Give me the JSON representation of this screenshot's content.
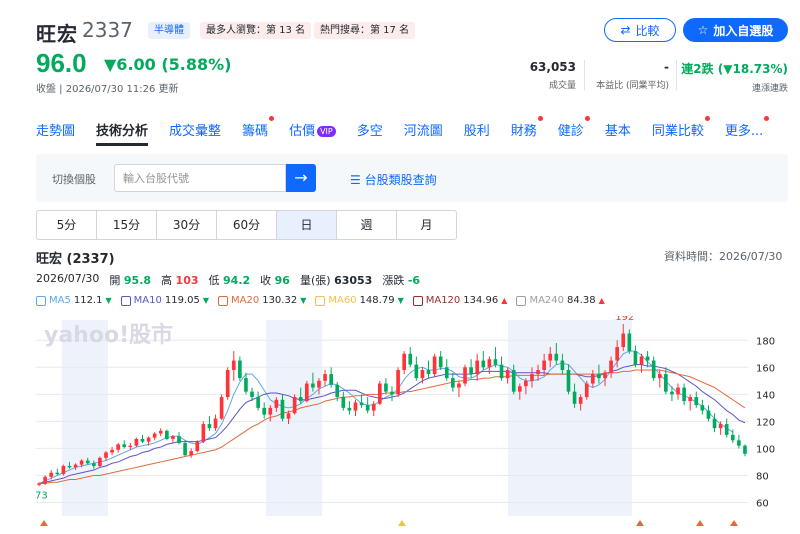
{
  "header": {
    "name": "旺宏",
    "code": "2337",
    "tags": {
      "sector": "半導體",
      "views": "最多人瀏覽：第 13 名",
      "hot": "熱門搜尋：第 17 名"
    },
    "compare_label": "比較",
    "watch_label": "加入自選股",
    "price": "96.0",
    "change": "▼6.00 (5.88%)",
    "update_line": "收盤 | 2026/07/30 11:26 更新"
  },
  "stats": [
    {
      "value": "63,053",
      "label": "成交量"
    },
    {
      "value": "-",
      "label": "本益比 (同業平均)"
    },
    {
      "value": "連2跌 (▼18.73%)",
      "label": "連漲連跌"
    }
  ],
  "tabs": [
    {
      "label": "走勢圖",
      "dot": false
    },
    {
      "label": "技術分析",
      "dot": false,
      "active": true
    },
    {
      "label": "成交彙整",
      "dot": false
    },
    {
      "label": "籌碼",
      "dot": true
    },
    {
      "label": "估價",
      "dot": false,
      "vip": "VIP"
    },
    {
      "label": "多空",
      "dot": false
    },
    {
      "label": "河流圖",
      "dot": false
    },
    {
      "label": "股利",
      "dot": false
    },
    {
      "label": "財務",
      "dot": true
    },
    {
      "label": "健診",
      "dot": true
    },
    {
      "label": "基本",
      "dot": false
    },
    {
      "label": "同業比較",
      "dot": true
    },
    {
      "label": "更多...",
      "dot": true
    }
  ],
  "search": {
    "switch_label": "切換個股",
    "placeholder": "輸入台股代號",
    "go_icon": "→",
    "category_link": "台股類股查詢"
  },
  "periods": [
    {
      "label": "5分"
    },
    {
      "label": "15分"
    },
    {
      "label": "30分"
    },
    {
      "label": "60分"
    },
    {
      "label": "日",
      "active": true
    },
    {
      "label": "週"
    },
    {
      "label": "月"
    }
  ],
  "chart_header": {
    "title": "旺宏 (2337)",
    "data_time": "資料時間：2026/07/30",
    "date": "2026/07/30",
    "open_label": "開",
    "open": "95.8",
    "high_label": "高",
    "high": "103",
    "low_label": "低",
    "low": "94.2",
    "close_label": "收",
    "close": "96",
    "volume_label": "量(張)",
    "volume": "63053",
    "change_label": "漲跌",
    "change": "-6"
  },
  "ma_legend": [
    {
      "label": "MA5",
      "value": "112.1",
      "arrow": "▼",
      "color": "#5fa8e6"
    },
    {
      "label": "MA10",
      "value": "119.05",
      "arrow": "▼",
      "color": "#5a55c8"
    },
    {
      "label": "MA20",
      "value": "130.32",
      "arrow": "▼",
      "color": "#e06b3c"
    },
    {
      "label": "MA60",
      "value": "148.79",
      "arrow": "▼",
      "color": "#f2c14a"
    },
    {
      "label": "MA120",
      "value": "134.96",
      "arrow": "▲",
      "color": "#9b2d2d"
    },
    {
      "label": "MA240",
      "value": "84.38",
      "arrow": "▲",
      "color": "#9aa0a6"
    }
  ],
  "colors": {
    "up": "#ff333a",
    "down": "#00ab5e",
    "accent": "#0f69ff"
  },
  "chart_data": {
    "type": "candlestick",
    "watermark": "yahoo!股市",
    "y_ticks": [
      60,
      80,
      100,
      120,
      140,
      160,
      180
    ],
    "ylim": [
      50,
      195
    ],
    "max_label": "192",
    "min_label": "73",
    "grid": true,
    "candles": [
      [
        73,
        75,
        72,
        74
      ],
      [
        74,
        80,
        73,
        79
      ],
      [
        79,
        84,
        77,
        82
      ],
      [
        82,
        85,
        80,
        81
      ],
      [
        81,
        88,
        80,
        87
      ],
      [
        87,
        90,
        85,
        86
      ],
      [
        86,
        89,
        84,
        88
      ],
      [
        88,
        92,
        86,
        91
      ],
      [
        91,
        93,
        88,
        89
      ],
      [
        89,
        91,
        85,
        87
      ],
      [
        87,
        94,
        86,
        93
      ],
      [
        93,
        98,
        91,
        97
      ],
      [
        97,
        101,
        95,
        99
      ],
      [
        99,
        104,
        97,
        103
      ],
      [
        103,
        106,
        100,
        101
      ],
      [
        101,
        104,
        99,
        102
      ],
      [
        102,
        108,
        101,
        107
      ],
      [
        107,
        110,
        104,
        105
      ],
      [
        105,
        109,
        102,
        108
      ],
      [
        108,
        112,
        106,
        111
      ],
      [
        111,
        115,
        109,
        113
      ],
      [
        113,
        114,
        106,
        107
      ],
      [
        107,
        110,
        104,
        109
      ],
      [
        109,
        112,
        103,
        104
      ],
      [
        104,
        106,
        94,
        95
      ],
      [
        95,
        100,
        93,
        98
      ],
      [
        98,
        106,
        97,
        105
      ],
      [
        105,
        120,
        104,
        118
      ],
      [
        118,
        124,
        113,
        115
      ],
      [
        115,
        125,
        113,
        122
      ],
      [
        122,
        140,
        121,
        138
      ],
      [
        138,
        160,
        136,
        158
      ],
      [
        158,
        172,
        150,
        165
      ],
      [
        165,
        168,
        150,
        152
      ],
      [
        152,
        156,
        140,
        142
      ],
      [
        142,
        145,
        135,
        138
      ],
      [
        138,
        142,
        128,
        130
      ],
      [
        130,
        134,
        122,
        125
      ],
      [
        125,
        132,
        120,
        130
      ],
      [
        130,
        138,
        127,
        136
      ],
      [
        136,
        140,
        120,
        122
      ],
      [
        122,
        128,
        118,
        126
      ],
      [
        126,
        140,
        125,
        138
      ],
      [
        138,
        145,
        133,
        135
      ],
      [
        135,
        150,
        134,
        148
      ],
      [
        148,
        156,
        142,
        145
      ],
      [
        145,
        152,
        140,
        150
      ],
      [
        150,
        158,
        146,
        155
      ],
      [
        155,
        160,
        145,
        147
      ],
      [
        147,
        149,
        135,
        138
      ],
      [
        138,
        142,
        128,
        130
      ],
      [
        130,
        135,
        125,
        128
      ],
      [
        128,
        136,
        124,
        134
      ],
      [
        134,
        140,
        130,
        132
      ],
      [
        132,
        138,
        126,
        128
      ],
      [
        128,
        135,
        124,
        133
      ],
      [
        133,
        150,
        132,
        148
      ],
      [
        148,
        152,
        140,
        142
      ],
      [
        142,
        146,
        135,
        140
      ],
      [
        140,
        160,
        138,
        158
      ],
      [
        158,
        172,
        155,
        170
      ],
      [
        170,
        175,
        160,
        162
      ],
      [
        162,
        168,
        150,
        152
      ],
      [
        152,
        160,
        148,
        158
      ],
      [
        158,
        165,
        152,
        155
      ],
      [
        155,
        170,
        153,
        168
      ],
      [
        168,
        172,
        158,
        160
      ],
      [
        160,
        166,
        150,
        152
      ],
      [
        152,
        156,
        142,
        145
      ],
      [
        145,
        150,
        138,
        148
      ],
      [
        148,
        162,
        146,
        160
      ],
      [
        160,
        166,
        152,
        155
      ],
      [
        155,
        170,
        150,
        165
      ],
      [
        165,
        172,
        158,
        160
      ],
      [
        160,
        168,
        155,
        166
      ],
      [
        166,
        175,
        160,
        162
      ],
      [
        162,
        168,
        150,
        152
      ],
      [
        152,
        160,
        148,
        158
      ],
      [
        158,
        162,
        140,
        142
      ],
      [
        142,
        148,
        136,
        146
      ],
      [
        146,
        152,
        140,
        150
      ],
      [
        150,
        160,
        145,
        155
      ],
      [
        155,
        162,
        150,
        158
      ],
      [
        158,
        170,
        154,
        165
      ],
      [
        165,
        175,
        160,
        170
      ],
      [
        170,
        178,
        162,
        165
      ],
      [
        165,
        170,
        155,
        158
      ],
      [
        158,
        162,
        140,
        142
      ],
      [
        142,
        148,
        130,
        133
      ],
      [
        133,
        140,
        128,
        138
      ],
      [
        138,
        150,
        136,
        148
      ],
      [
        148,
        158,
        145,
        155
      ],
      [
        155,
        162,
        148,
        152
      ],
      [
        152,
        158,
        146,
        156
      ],
      [
        156,
        168,
        152,
        165
      ],
      [
        165,
        180,
        160,
        175
      ],
      [
        175,
        192,
        172,
        185
      ],
      [
        185,
        188,
        170,
        172
      ],
      [
        172,
        176,
        160,
        162
      ],
      [
        162,
        170,
        156,
        168
      ],
      [
        168,
        172,
        160,
        165
      ],
      [
        165,
        168,
        150,
        152
      ],
      [
        152,
        158,
        145,
        155
      ],
      [
        155,
        160,
        140,
        142
      ],
      [
        142,
        146,
        135,
        140
      ],
      [
        140,
        148,
        136,
        145
      ],
      [
        145,
        148,
        132,
        135
      ],
      [
        135,
        140,
        128,
        138
      ],
      [
        138,
        142,
        130,
        132
      ],
      [
        132,
        136,
        125,
        128
      ],
      [
        128,
        132,
        120,
        122
      ],
      [
        122,
        126,
        112,
        115
      ],
      [
        115,
        120,
        110,
        118
      ],
      [
        118,
        122,
        108,
        110
      ],
      [
        110,
        114,
        104,
        106
      ],
      [
        106,
        110,
        100,
        102
      ],
      [
        102,
        103,
        94.2,
        96
      ]
    ],
    "ma": {
      "MA5": [
        74,
        76,
        78,
        80,
        82,
        84,
        86,
        87,
        88,
        89,
        90,
        91,
        93,
        95,
        97,
        99,
        101,
        102,
        103,
        104,
        106,
        108,
        109,
        109,
        106,
        104,
        103,
        105,
        108,
        111,
        118,
        128,
        140,
        149,
        155,
        155,
        150,
        143,
        136,
        133,
        131,
        130,
        131,
        133,
        137,
        140,
        144,
        146,
        148,
        147,
        144,
        141,
        137,
        133,
        132,
        132,
        135,
        138,
        140,
        144,
        151,
        156,
        159,
        160,
        158,
        158,
        159,
        159,
        157,
        153,
        152,
        152,
        154,
        158,
        160,
        162,
        161,
        160,
        157,
        152,
        150,
        150,
        151,
        153,
        158,
        162,
        163,
        162,
        157,
        152,
        147,
        145,
        147,
        151,
        158,
        164,
        170,
        172,
        172,
        169,
        164,
        160,
        155,
        150,
        145,
        141,
        139,
        137,
        134,
        131,
        127,
        122,
        118,
        115,
        112
      ],
      "MA10": [
        74,
        75,
        76,
        77,
        78,
        80,
        81,
        82,
        83,
        84,
        86,
        87,
        89,
        90,
        92,
        94,
        95,
        97,
        98,
        100,
        101,
        103,
        104,
        105,
        105,
        105,
        105,
        106,
        107,
        108,
        112,
        117,
        123,
        129,
        134,
        136,
        138,
        140,
        141,
        141,
        140,
        139,
        137,
        136,
        136,
        137,
        138,
        139,
        141,
        142,
        143,
        143,
        143,
        141,
        139,
        138,
        137,
        137,
        138,
        139,
        141,
        144,
        147,
        150,
        152,
        153,
        154,
        155,
        155,
        155,
        155,
        155,
        156,
        157,
        157,
        157,
        157,
        157,
        156,
        156,
        156,
        156,
        156,
        156,
        155,
        155,
        155,
        155,
        155,
        154,
        153,
        153,
        154,
        155,
        157,
        158,
        160,
        161,
        162,
        162,
        161,
        161,
        160,
        159,
        157,
        155,
        152,
        149,
        146,
        142,
        139,
        136,
        132,
        128,
        125,
        121,
        119
      ],
      "MA20": [
        74,
        74,
        75,
        75,
        76,
        77,
        77,
        78,
        79,
        80,
        80,
        81,
        82,
        83,
        84,
        85,
        86,
        87,
        88,
        89,
        90,
        91,
        92,
        93,
        94,
        95,
        96,
        97,
        98,
        99,
        101,
        104,
        107,
        110,
        113,
        116,
        118,
        121,
        123,
        124,
        126,
        127,
        128,
        130,
        131,
        132,
        133,
        135,
        136,
        137,
        138,
        138,
        139,
        139,
        140,
        140,
        140,
        141,
        141,
        141,
        142,
        142,
        143,
        144,
        145,
        146,
        147,
        148,
        149,
        150,
        150,
        151,
        151,
        152,
        152,
        153,
        153,
        153,
        154,
        154,
        154,
        154,
        154,
        154,
        155,
        155,
        155,
        155,
        155,
        155,
        155,
        155,
        155,
        156,
        156,
        156,
        157,
        157,
        158,
        158,
        158,
        158,
        158,
        157,
        156,
        155,
        154,
        153,
        151,
        149,
        147,
        145,
        142,
        139,
        136,
        133,
        130
      ]
    }
  }
}
